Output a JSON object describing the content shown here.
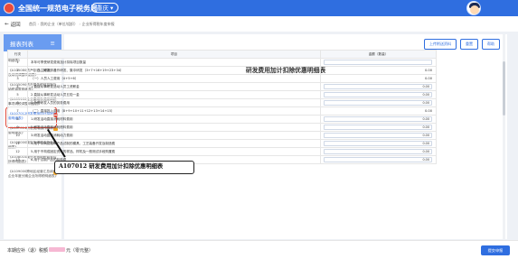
{
  "header": {
    "app_title": "全国统一规范电子税务局",
    "region": "重庆",
    "region_icon": "chevron-down-icon"
  },
  "breadcrumb": {
    "back": "返回",
    "items": [
      "首页",
      "我的企业（单位/组织）",
      "企业所得税年度申报"
    ]
  },
  "sidebar": {
    "title": "报表列表",
    "items": [
      {
        "label": "《A105070捐赠支出及纳税调整明细表》",
        "warn": false
      },
      {
        "label": "《A105080资产折旧、摊销情况及纳税调整明细表》",
        "warn": false
      },
      {
        "label": "《A105090资产损失税前扣除及纳税调整明细表》",
        "warn": false
      },
      {
        "label": "《A105100企业重组及递延纳税事项纳税调整明细表》",
        "warn": false
      },
      {
        "label": "《A107012研发费用加计扣除优惠明细表》",
        "warn": true,
        "active": true
      },
      {
        "label": "《A107014研发费用加计扣除优惠明细表》",
        "warn": true
      },
      {
        "label": "《A108000境外所得税收抵免明细表》",
        "warn": false
      },
      {
        "label": "《A108010境外所得纳税调整后所得明细表》",
        "warn": false
      },
      {
        "label": "《A109000跨地区经营汇总纳税企业年度分摊企业所得税明细表》",
        "warn": true
      }
    ]
  },
  "toolbar": {
    "btn1": "上传附送资料",
    "btn2": "重置",
    "btn3": "帮助"
  },
  "form": {
    "title": "研发费用加计扣除优惠明细表",
    "col_no": "行次",
    "col_item": "项目",
    "col_amount": "金额（数量）",
    "rows": [
      {
        "no": "1",
        "item": "本年可享受研发费用加计扣除项目数量",
        "amount": "",
        "input": true
      },
      {
        "no": "2",
        "item": "一、自主研发、合作研发、集中研发（3+7+16+19+23+34）",
        "amount": "0.00",
        "input": false
      },
      {
        "no": "3",
        "item": "（一）人员人工费用（4+5+6）",
        "amount": "0.00",
        "input": false
      },
      {
        "no": "4",
        "item": "1.直接从事研发活动人员工资薪金",
        "amount": "0.00",
        "input": true
      },
      {
        "no": "5",
        "item": "2.直接从事研发活动人员五险一金",
        "amount": "0.00",
        "input": true
      },
      {
        "no": "6",
        "item": "3.外聘研发人员的劳务费用",
        "amount": "0.00",
        "input": true
      },
      {
        "no": "7",
        "item": "（二）直接投入费用（8+9+10+11+12+13+14+15）",
        "amount": "0.00",
        "input": false
      },
      {
        "no": "8",
        "item": "1.研发活动直接消耗材料费用",
        "amount": "0.00",
        "input": true
      },
      {
        "no": "9",
        "item": "2.研发活动直接消耗燃料费用",
        "amount": "0.00",
        "input": true
      },
      {
        "no": "10",
        "item": "3.研发活动直接消耗动力费用",
        "amount": "0.00",
        "input": true
      },
      {
        "no": "11",
        "item": "4.用于中间试验和产品试制的模具、工艺装备开发及制造费",
        "amount": "0.00",
        "input": true
      },
      {
        "no": "12",
        "item": "5.用于不构成固定资产的样品、样机及一般测试手段购置费",
        "amount": "0.00",
        "input": true
      },
      {
        "no": "13",
        "item": "6.用于试制产品的检验费",
        "amount": "0.00",
        "input": true
      }
    ]
  },
  "footer": {
    "label": "本期应补（退）税额",
    "suffix": "元（零元整）",
    "submit": "提交申报"
  },
  "callout": {
    "text": "A107012 研发费用加计扣除优惠明细表"
  },
  "colors": {
    "brand": "#2f6ee0",
    "sidebar_head": "#6a9cf0",
    "warn": "#f5a623",
    "highlight": "#e04b3c"
  }
}
